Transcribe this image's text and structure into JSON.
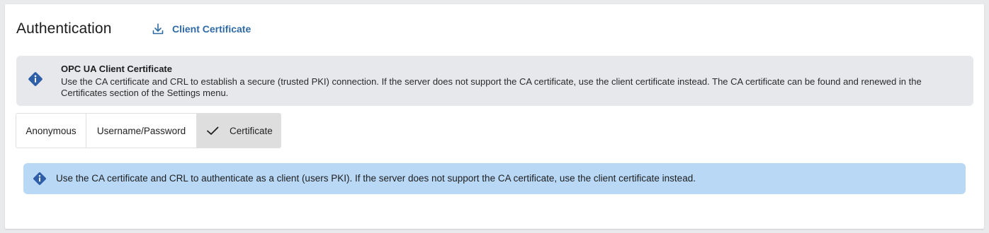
{
  "header": {
    "title": "Authentication",
    "download_label": "Client Certificate"
  },
  "info": {
    "heading": "OPC UA Client Certificate",
    "body": "Use the CA certificate and CRL to establish a secure (trusted PKI) connection. If the server does not support the CA certificate, use the client certificate instead. The CA certificate can be found and renewed in the Certificates section of the Settings menu."
  },
  "auth_modes": {
    "options": [
      "Anonymous",
      "Username/Password",
      "Certificate"
    ],
    "selected": "Certificate"
  },
  "notice": {
    "text": "Use the CA certificate and CRL to authenticate as a client (users PKI). If the server does not support the CA certificate, use the client certificate instead."
  },
  "colors": {
    "accent": "#2f6aa5",
    "info_icon": "#2f5fa8",
    "info_panel_bg": "#e6e8ec",
    "notice_bg": "#b8d8f6",
    "selected_segment_bg": "#dedede"
  },
  "icons": {
    "download": "download-icon",
    "info": "info-icon",
    "check": "check-icon"
  }
}
